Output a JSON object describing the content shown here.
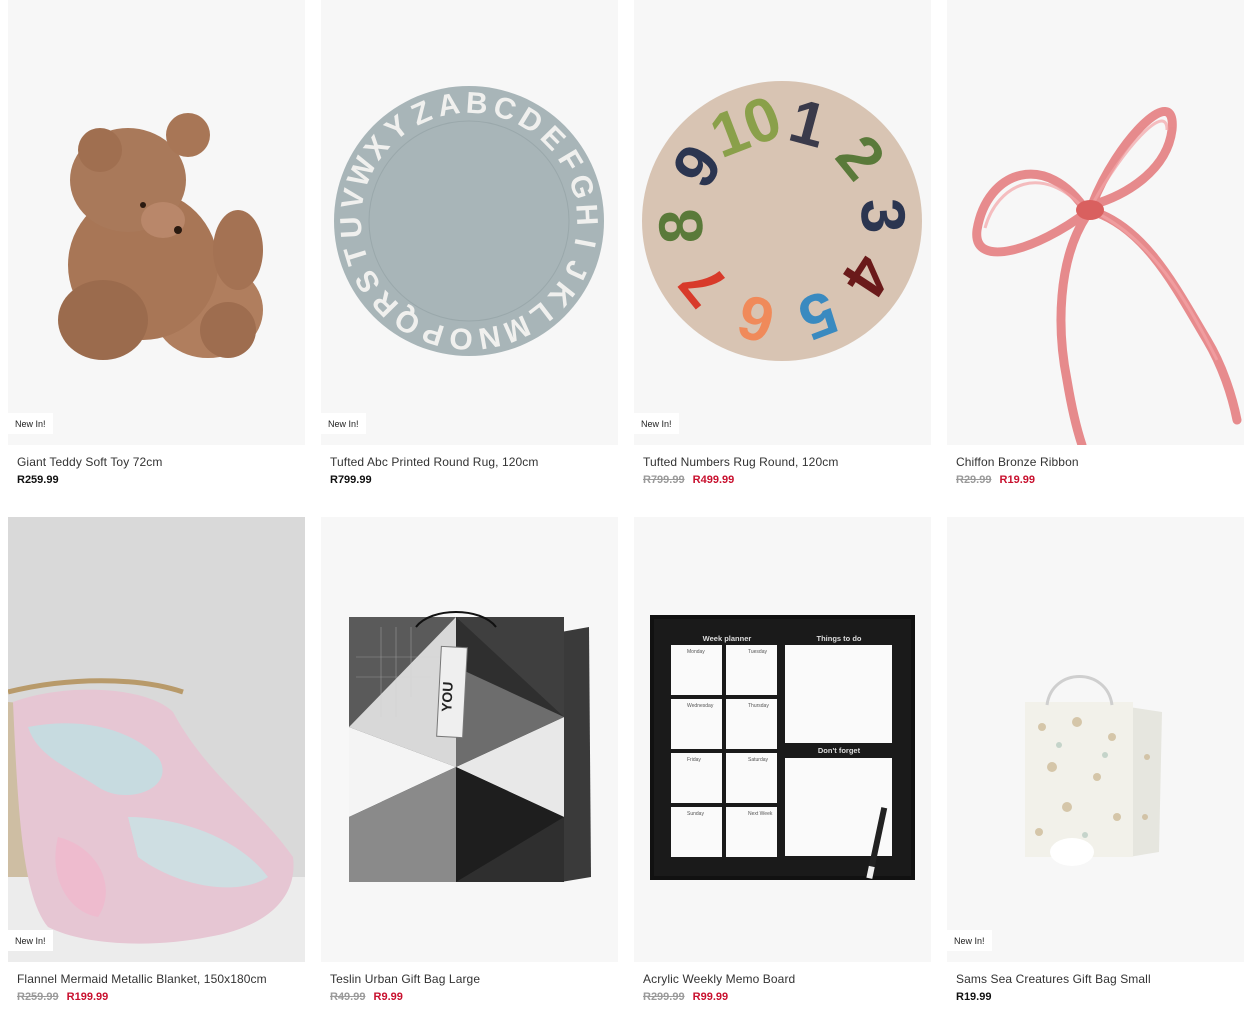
{
  "products": [
    {
      "name": "Giant Teddy Soft Toy 72cm",
      "badge": "New In!",
      "price": "R259.99",
      "old_price": "",
      "sale_price": ""
    },
    {
      "name": "Tufted Abc Printed Round Rug, 120cm",
      "badge": "New In!",
      "price": "R799.99",
      "old_price": "",
      "sale_price": ""
    },
    {
      "name": "Tufted Numbers Rug Round, 120cm",
      "badge": "New In!",
      "price": "",
      "old_price": "R799.99",
      "sale_price": "R499.99"
    },
    {
      "name": "Chiffon Bronze Ribbon",
      "badge": "",
      "price": "",
      "old_price": "R29.99",
      "sale_price": "R19.99"
    },
    {
      "name": "Flannel Mermaid Metallic Blanket, 150x180cm",
      "badge": "New In!",
      "price": "",
      "old_price": "R259.99",
      "sale_price": "R199.99"
    },
    {
      "name": "Teslin Urban Gift Bag Large",
      "badge": "",
      "price": "",
      "old_price": "R49.99",
      "sale_price": "R9.99"
    },
    {
      "name": "Acrylic Weekly Memo Board",
      "badge": "",
      "price": "",
      "old_price": "R299.99",
      "sale_price": "R99.99"
    },
    {
      "name": "Sams Sea Creatures Gift Bag Small",
      "badge": "New In!",
      "price": "R19.99",
      "old_price": "",
      "sale_price": ""
    }
  ],
  "rug_abc_letters": "ABCDEFGHIJKLMNOPQRSTUVWXYZ",
  "rug_numbers": [
    "1",
    "2",
    "3",
    "4",
    "5",
    "6",
    "7",
    "8",
    "9",
    "10"
  ],
  "memo_board": {
    "heading_left": "Week planner",
    "heading_right": "Things to do",
    "heading_forget": "Don't forget",
    "days": [
      "Monday",
      "Tuesday",
      "Wednesday",
      "Thursday",
      "Friday",
      "Saturday",
      "Sunday",
      "Next Week"
    ]
  },
  "gift_tag_text": "YOU",
  "colors": {
    "sale": "#c8102e",
    "old": "#9a9a9a",
    "regular": "#111111",
    "tile_bg": "#f7f7f7"
  }
}
